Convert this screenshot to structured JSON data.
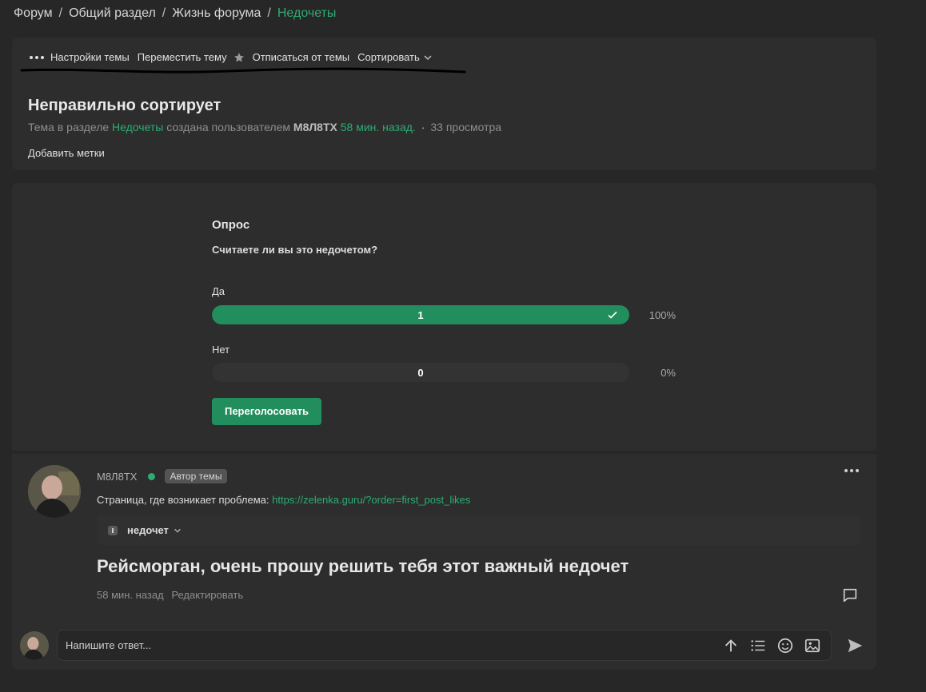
{
  "breadcrumb": {
    "items": [
      "Форум",
      "Общий раздел",
      "Жизнь форума"
    ],
    "current": "Недочеты",
    "separator": "/"
  },
  "actions": {
    "settings": "Настройки темы",
    "move": "Переместить тему",
    "unsubscribe": "Отписаться от темы",
    "sort": "Сортировать"
  },
  "topic": {
    "title": "Неправильно сортирует",
    "meta_prefix": "Тема в разделе",
    "section": "Недочеты",
    "meta_created": "создана пользователем",
    "author": "M8Л8TX",
    "time": "58 мин. назад.",
    "views": "33 просмотра",
    "add_tags": "Добавить метки"
  },
  "poll": {
    "title": "Опрос",
    "question": "Считаете ли вы это недочетом?",
    "options": [
      {
        "label": "Да",
        "votes": "1",
        "percent": "100%",
        "fill": 1.0
      },
      {
        "label": "Нет",
        "votes": "0",
        "percent": "0%",
        "fill": 0.0
      }
    ],
    "revote": "Переголосовать"
  },
  "post": {
    "author": "M8Л8TX",
    "badge": "Автор темы",
    "line_label": "Страница, где возникает проблема:",
    "line_link": "https://zelenka.guru/?order=first_post_likes",
    "tag": "недочет",
    "heading": "Рейсморган, очень прошу решить тебя этот важный недочет",
    "time": "58 мин. назад",
    "edit": "Редактировать"
  },
  "reply": {
    "placeholder": "Напишите ответ..."
  },
  "colors": {
    "accent": "#2bad72",
    "button": "#228e5d",
    "background": "#272727",
    "panel": "#2d2d2d"
  }
}
